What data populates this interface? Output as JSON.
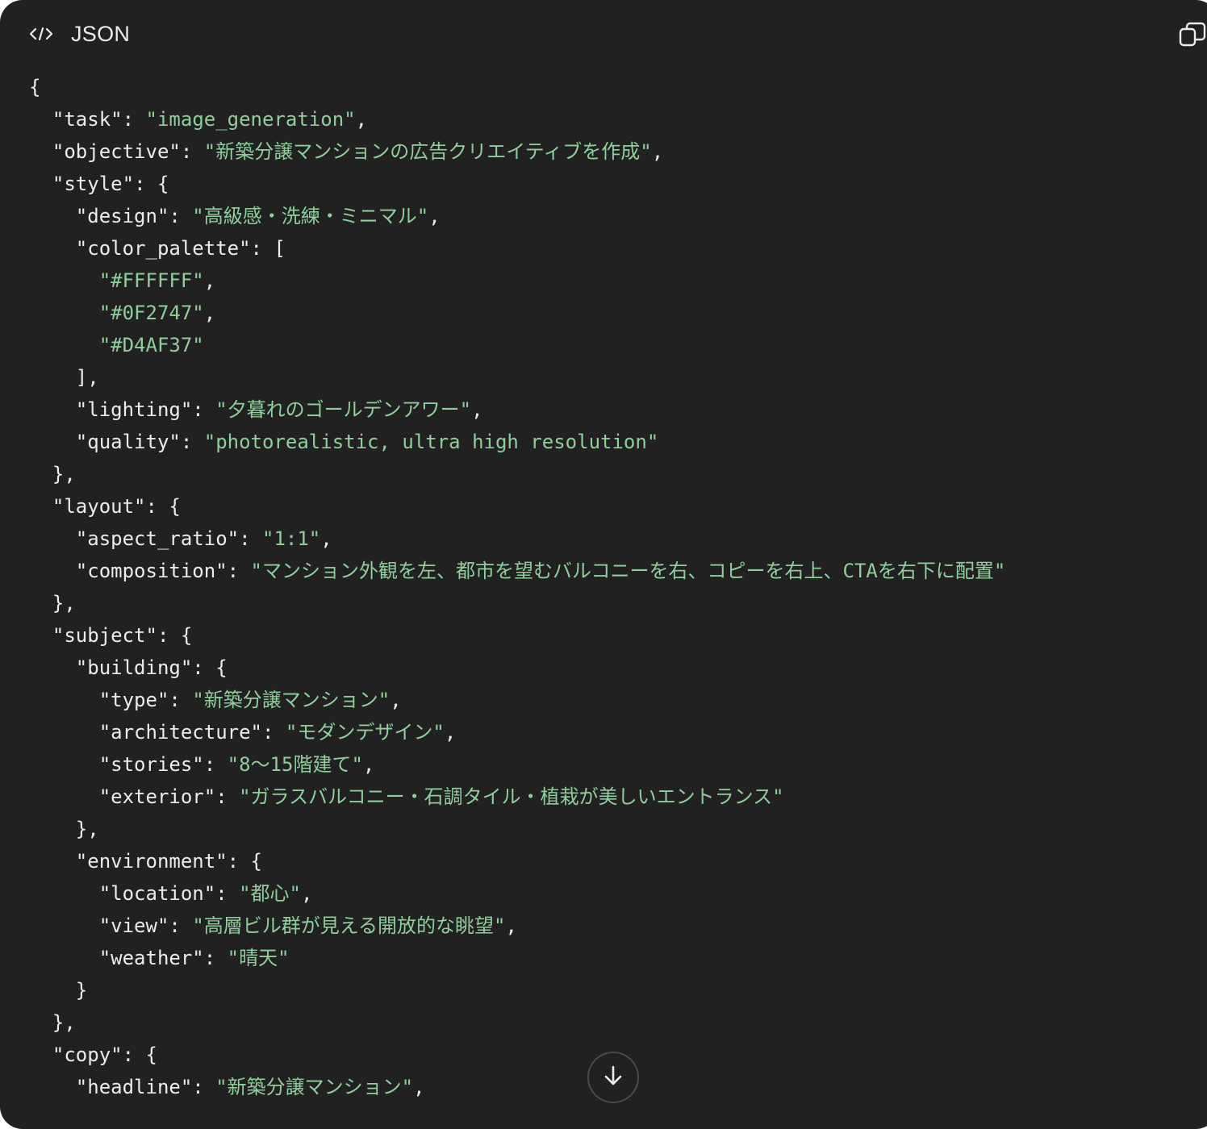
{
  "header": {
    "language": "JSON",
    "code_icon": "code-brackets-icon",
    "copy_icon": "copy-icon"
  },
  "scroll_button": {
    "icon": "arrow-down-icon"
  },
  "colors": {
    "panel_background": "#212121",
    "text": "#ececec",
    "string": "#8fcf9a"
  },
  "code_lines": [
    [
      {
        "t": "{",
        "c": "p"
      }
    ],
    [
      {
        "t": "  ",
        "c": "p"
      },
      {
        "t": "\"task\"",
        "c": "k"
      },
      {
        "t": ": ",
        "c": "p"
      },
      {
        "t": "\"image_generation\"",
        "c": "s"
      },
      {
        "t": ",",
        "c": "p"
      }
    ],
    [
      {
        "t": "  ",
        "c": "p"
      },
      {
        "t": "\"objective\"",
        "c": "k"
      },
      {
        "t": ": ",
        "c": "p"
      },
      {
        "t": "\"新築分譲マンションの広告クリエイティブを作成\"",
        "c": "s"
      },
      {
        "t": ",",
        "c": "p"
      }
    ],
    [
      {
        "t": "  ",
        "c": "p"
      },
      {
        "t": "\"style\"",
        "c": "k"
      },
      {
        "t": ": {",
        "c": "p"
      }
    ],
    [
      {
        "t": "    ",
        "c": "p"
      },
      {
        "t": "\"design\"",
        "c": "k"
      },
      {
        "t": ": ",
        "c": "p"
      },
      {
        "t": "\"高級感・洗練・ミニマル\"",
        "c": "s"
      },
      {
        "t": ",",
        "c": "p"
      }
    ],
    [
      {
        "t": "    ",
        "c": "p"
      },
      {
        "t": "\"color_palette\"",
        "c": "k"
      },
      {
        "t": ": [",
        "c": "p"
      }
    ],
    [
      {
        "t": "      ",
        "c": "p"
      },
      {
        "t": "\"#FFFFFF\"",
        "c": "s"
      },
      {
        "t": ",",
        "c": "p"
      }
    ],
    [
      {
        "t": "      ",
        "c": "p"
      },
      {
        "t": "\"#0F2747\"",
        "c": "s"
      },
      {
        "t": ",",
        "c": "p"
      }
    ],
    [
      {
        "t": "      ",
        "c": "p"
      },
      {
        "t": "\"#D4AF37\"",
        "c": "s"
      }
    ],
    [
      {
        "t": "    ],",
        "c": "p"
      }
    ],
    [
      {
        "t": "    ",
        "c": "p"
      },
      {
        "t": "\"lighting\"",
        "c": "k"
      },
      {
        "t": ": ",
        "c": "p"
      },
      {
        "t": "\"夕暮れのゴールデンアワー\"",
        "c": "s"
      },
      {
        "t": ",",
        "c": "p"
      }
    ],
    [
      {
        "t": "    ",
        "c": "p"
      },
      {
        "t": "\"quality\"",
        "c": "k"
      },
      {
        "t": ": ",
        "c": "p"
      },
      {
        "t": "\"photorealistic, ultra high resolution\"",
        "c": "s"
      }
    ],
    [
      {
        "t": "  },",
        "c": "p"
      }
    ],
    [
      {
        "t": "  ",
        "c": "p"
      },
      {
        "t": "\"layout\"",
        "c": "k"
      },
      {
        "t": ": {",
        "c": "p"
      }
    ],
    [
      {
        "t": "    ",
        "c": "p"
      },
      {
        "t": "\"aspect_ratio\"",
        "c": "k"
      },
      {
        "t": ": ",
        "c": "p"
      },
      {
        "t": "\"1:1\"",
        "c": "s"
      },
      {
        "t": ",",
        "c": "p"
      }
    ],
    [
      {
        "t": "    ",
        "c": "p"
      },
      {
        "t": "\"composition\"",
        "c": "k"
      },
      {
        "t": ": ",
        "c": "p"
      },
      {
        "t": "\"マンション外観を左、都市を望むバルコニーを右、コピーを右上、CTAを右下に配置\"",
        "c": "s"
      }
    ],
    [
      {
        "t": "  },",
        "c": "p"
      }
    ],
    [
      {
        "t": "  ",
        "c": "p"
      },
      {
        "t": "\"subject\"",
        "c": "k"
      },
      {
        "t": ": {",
        "c": "p"
      }
    ],
    [
      {
        "t": "    ",
        "c": "p"
      },
      {
        "t": "\"building\"",
        "c": "k"
      },
      {
        "t": ": {",
        "c": "p"
      }
    ],
    [
      {
        "t": "      ",
        "c": "p"
      },
      {
        "t": "\"type\"",
        "c": "k"
      },
      {
        "t": ": ",
        "c": "p"
      },
      {
        "t": "\"新築分譲マンション\"",
        "c": "s"
      },
      {
        "t": ",",
        "c": "p"
      }
    ],
    [
      {
        "t": "      ",
        "c": "p"
      },
      {
        "t": "\"architecture\"",
        "c": "k"
      },
      {
        "t": ": ",
        "c": "p"
      },
      {
        "t": "\"モダンデザイン\"",
        "c": "s"
      },
      {
        "t": ",",
        "c": "p"
      }
    ],
    [
      {
        "t": "      ",
        "c": "p"
      },
      {
        "t": "\"stories\"",
        "c": "k"
      },
      {
        "t": ": ",
        "c": "p"
      },
      {
        "t": "\"8〜15階建て\"",
        "c": "s"
      },
      {
        "t": ",",
        "c": "p"
      }
    ],
    [
      {
        "t": "      ",
        "c": "p"
      },
      {
        "t": "\"exterior\"",
        "c": "k"
      },
      {
        "t": ": ",
        "c": "p"
      },
      {
        "t": "\"ガラスバルコニー・石調タイル・植栽が美しいエントランス\"",
        "c": "s"
      }
    ],
    [
      {
        "t": "    },",
        "c": "p"
      }
    ],
    [
      {
        "t": "    ",
        "c": "p"
      },
      {
        "t": "\"environment\"",
        "c": "k"
      },
      {
        "t": ": {",
        "c": "p"
      }
    ],
    [
      {
        "t": "      ",
        "c": "p"
      },
      {
        "t": "\"location\"",
        "c": "k"
      },
      {
        "t": ": ",
        "c": "p"
      },
      {
        "t": "\"都心\"",
        "c": "s"
      },
      {
        "t": ",",
        "c": "p"
      }
    ],
    [
      {
        "t": "      ",
        "c": "p"
      },
      {
        "t": "\"view\"",
        "c": "k"
      },
      {
        "t": ": ",
        "c": "p"
      },
      {
        "t": "\"高層ビル群が見える開放的な眺望\"",
        "c": "s"
      },
      {
        "t": ",",
        "c": "p"
      }
    ],
    [
      {
        "t": "      ",
        "c": "p"
      },
      {
        "t": "\"weather\"",
        "c": "k"
      },
      {
        "t": ": ",
        "c": "p"
      },
      {
        "t": "\"晴天\"",
        "c": "s"
      }
    ],
    [
      {
        "t": "    }",
        "c": "p"
      }
    ],
    [
      {
        "t": "  },",
        "c": "p"
      }
    ],
    [
      {
        "t": "  ",
        "c": "p"
      },
      {
        "t": "\"copy\"",
        "c": "k"
      },
      {
        "t": ": {",
        "c": "p"
      }
    ],
    [
      {
        "t": "    ",
        "c": "p"
      },
      {
        "t": "\"headline\"",
        "c": "k"
      },
      {
        "t": ": ",
        "c": "p"
      },
      {
        "t": "\"新築分譲マンション\"",
        "c": "s"
      },
      {
        "t": ",",
        "c": "p"
      }
    ]
  ]
}
